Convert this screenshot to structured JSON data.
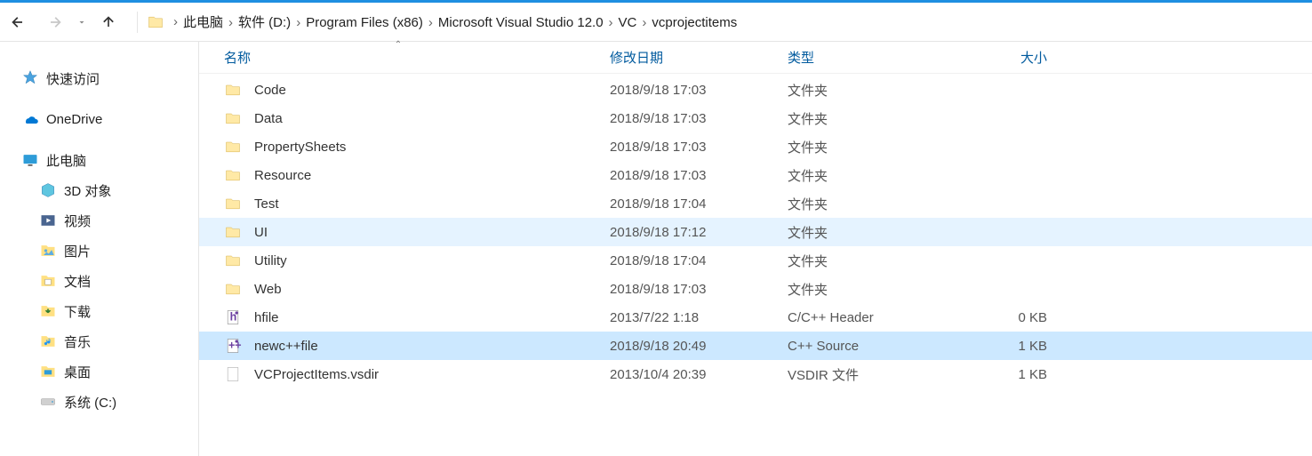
{
  "breadcrumb": {
    "items": [
      "此电脑",
      "软件 (D:)",
      "Program Files (x86)",
      "Microsoft Visual Studio 12.0",
      "VC",
      "vcprojectitems"
    ]
  },
  "sidebar": {
    "items": [
      {
        "label": "快速访问",
        "icon": "quick-access",
        "indent": false
      },
      {
        "label": "OneDrive",
        "icon": "onedrive",
        "indent": false,
        "spacer": true
      },
      {
        "label": "此电脑",
        "icon": "pc",
        "indent": false,
        "spacer": true
      },
      {
        "label": "3D 对象",
        "icon": "3d",
        "indent": true
      },
      {
        "label": "视频",
        "icon": "video",
        "indent": true
      },
      {
        "label": "图片",
        "icon": "pictures",
        "indent": true
      },
      {
        "label": "文档",
        "icon": "documents",
        "indent": true
      },
      {
        "label": "下载",
        "icon": "downloads",
        "indent": true
      },
      {
        "label": "音乐",
        "icon": "music",
        "indent": true
      },
      {
        "label": "桌面",
        "icon": "desktop",
        "indent": true
      },
      {
        "label": "系统 (C:)",
        "icon": "drive",
        "indent": true
      }
    ]
  },
  "columns": {
    "name": "名称",
    "date": "修改日期",
    "type": "类型",
    "size": "大小",
    "sort": "name",
    "direction": "asc"
  },
  "files": [
    {
      "name": "Code",
      "date": "2018/9/18 17:03",
      "type": "文件夹",
      "size": "",
      "icon": "folder"
    },
    {
      "name": "Data",
      "date": "2018/9/18 17:03",
      "type": "文件夹",
      "size": "",
      "icon": "folder"
    },
    {
      "name": "PropertySheets",
      "date": "2018/9/18 17:03",
      "type": "文件夹",
      "size": "",
      "icon": "folder"
    },
    {
      "name": "Resource",
      "date": "2018/9/18 17:03",
      "type": "文件夹",
      "size": "",
      "icon": "folder"
    },
    {
      "name": "Test",
      "date": "2018/9/18 17:04",
      "type": "文件夹",
      "size": "",
      "icon": "folder"
    },
    {
      "name": "UI",
      "date": "2018/9/18 17:12",
      "type": "文件夹",
      "size": "",
      "icon": "folder",
      "hover": true
    },
    {
      "name": "Utility",
      "date": "2018/9/18 17:04",
      "type": "文件夹",
      "size": "",
      "icon": "folder"
    },
    {
      "name": "Web",
      "date": "2018/9/18 17:03",
      "type": "文件夹",
      "size": "",
      "icon": "folder"
    },
    {
      "name": "hfile",
      "date": "2013/7/22 1:18",
      "type": "C/C++ Header",
      "size": "0 KB",
      "icon": "hfile"
    },
    {
      "name": "newc++file",
      "date": "2018/9/18 20:49",
      "type": "C++ Source",
      "size": "1 KB",
      "icon": "cppfile",
      "selected": true
    },
    {
      "name": "VCProjectItems.vsdir",
      "date": "2013/10/4 20:39",
      "type": "VSDIR 文件",
      "size": "1 KB",
      "icon": "file"
    }
  ]
}
